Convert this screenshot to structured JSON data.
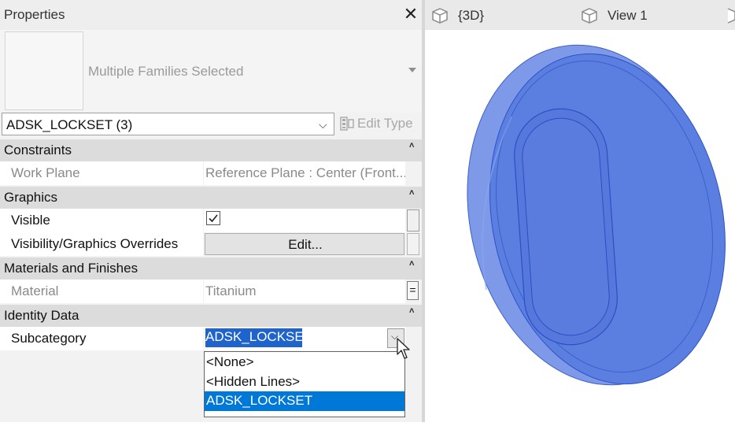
{
  "properties": {
    "title": "Properties",
    "preview_label": "Multiple Families Selected",
    "type_selector": "ADSK_LOCKSET (3)",
    "edit_type": "Edit Type",
    "sections": {
      "constraints": "Constraints",
      "graphics": "Graphics",
      "materials": "Materials and Finishes",
      "identity": "Identity Data"
    },
    "rows": {
      "work_plane": {
        "name": "Work Plane",
        "value": "Reference Plane : Center (Front..."
      },
      "visible": {
        "name": "Visible",
        "checked": true
      },
      "vg_overrides": {
        "name": "Visibility/Graphics Overrides",
        "button": "Edit..."
      },
      "material": {
        "name": "Material",
        "value": "Titanium",
        "browse": "="
      },
      "subcategory": {
        "name": "Subcategory",
        "value": "ADSK_LOCKSET"
      }
    },
    "subcategory_options": [
      "<None>",
      "<Hidden Lines>",
      "ADSK_LOCKSET"
    ],
    "subcategory_selected_index": 2
  },
  "views": {
    "tabs": [
      "{3D}",
      "View 1"
    ]
  },
  "colors": {
    "selection": "#0078d7",
    "model_fill": "#4f75db"
  },
  "icons": {
    "close": "close-icon",
    "edit_type": "edit-type-icon",
    "view": "3d-view-icon",
    "cursor": "mouse-cursor-icon"
  }
}
